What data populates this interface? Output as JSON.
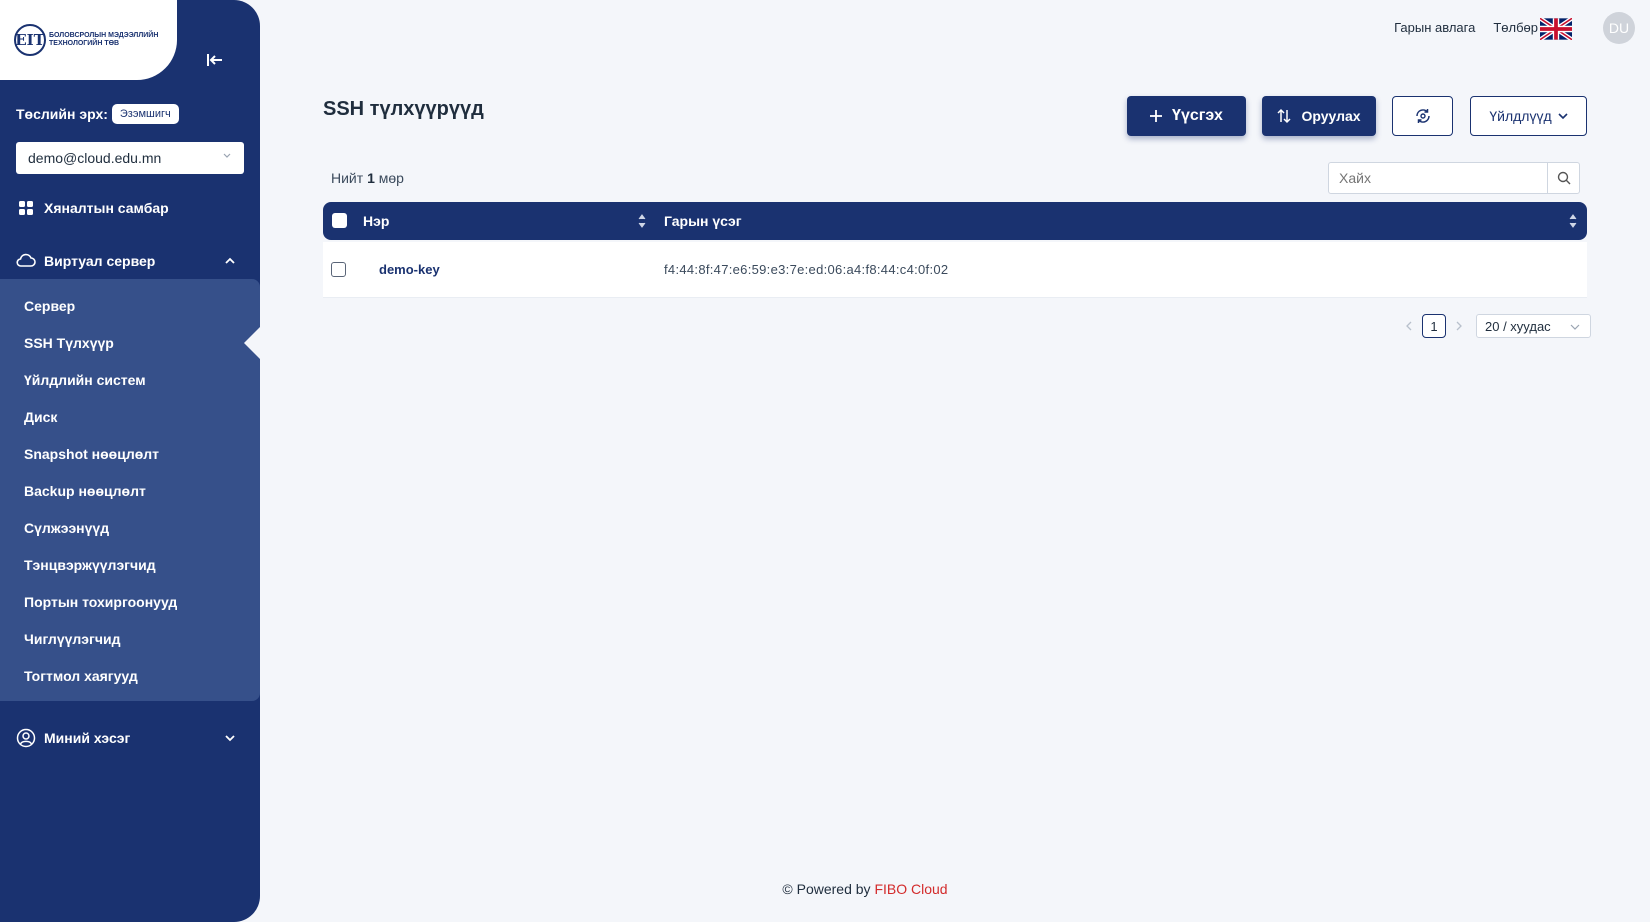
{
  "sidebar": {
    "logo_text": "Боловсролын мэдээллийн технологийн төв",
    "logo_mark": "ЕIТ",
    "role_label": "Төслийн эрх:",
    "role_badge": "Эзэмшигч",
    "account": "demo@cloud.edu.mn",
    "dashboard": "Хяналтын самбар",
    "virtual_server": "Виртуал сервер",
    "submenu": [
      "Сервер",
      "SSH Түлхүүр",
      "Үйлдлийн систем",
      "Диск",
      "Snapshot нөөцлөлт",
      "Backup нөөцлөлт",
      "Сүлжээнүүд",
      "Тэнцвэржүүлэгчид",
      "Портын тохиргоонууд",
      "Чиглүүлэгчид",
      "Тогтмол хаягууд"
    ],
    "my_section": "Миний хэсэг",
    "active_item": "SSH Түлхүүр"
  },
  "header": {
    "guide": "Гарын авлага",
    "payment": "Төлбөр",
    "language_icon": "uk-flag-icon",
    "avatar_initials": "DU"
  },
  "main": {
    "title": "SSH түлхүүрүүд",
    "create_button": "Үүсгэх",
    "import_button": "Оруулах",
    "refresh_icon": "refresh-icon",
    "actions_button": "Үйлдлүүд",
    "total_prefix": "Нийт",
    "total_count": "1",
    "total_suffix": "мөр",
    "search_placeholder": "Хайх",
    "columns": [
      "Нэр",
      "Гарын үсэг"
    ],
    "rows": [
      {
        "name": "demo-key",
        "fingerprint": "f4:44:8f:47:e6:59:e3:7e:ed:06:a4:f8:44:c4:0f:02"
      }
    ],
    "pagination": {
      "current_page": "1",
      "page_size": "20 / хуудас"
    }
  },
  "footer": {
    "prefix": "© Powered by",
    "brand": "FIBO Cloud"
  },
  "colors": {
    "primary": "#1a3270",
    "submenu_bg": "#36508a",
    "background": "#f4f6fa",
    "brand_red": "#d32b2b"
  }
}
